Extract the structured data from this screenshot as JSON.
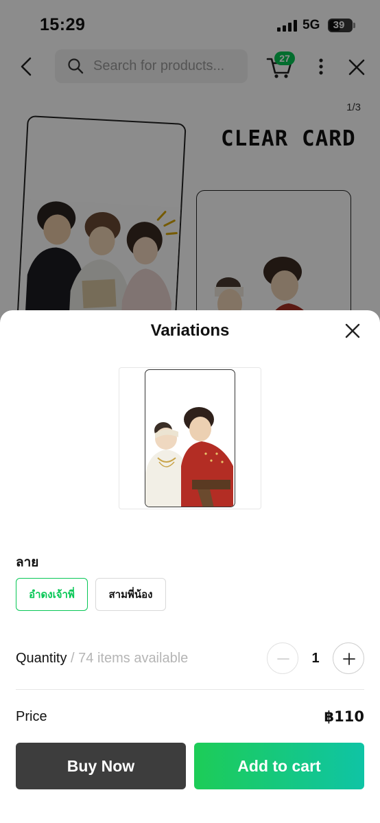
{
  "status_bar": {
    "time": "15:29",
    "network": "5G",
    "battery": "39"
  },
  "top_nav": {
    "search_placeholder": "Search for products...",
    "cart_count": "27"
  },
  "gallery": {
    "page_indicator": "1/3",
    "heading": "CLEAR CARD"
  },
  "sheet": {
    "title": "Variations",
    "option_group": {
      "label": "ลาย",
      "options": [
        {
          "label": "อำดงเจ้าพี่",
          "selected": true
        },
        {
          "label": "สามพี่น้อง",
          "selected": false
        }
      ]
    },
    "quantity": {
      "label": "Quantity",
      "separator": "/",
      "available": "74 items available",
      "value": "1"
    },
    "price": {
      "label": "Price",
      "value": "฿110"
    },
    "actions": {
      "buy_now": "Buy Now",
      "add_to_cart": "Add to cart"
    }
  },
  "colors": {
    "accent": "#06c755",
    "dark_button": "#3d3d3d"
  }
}
